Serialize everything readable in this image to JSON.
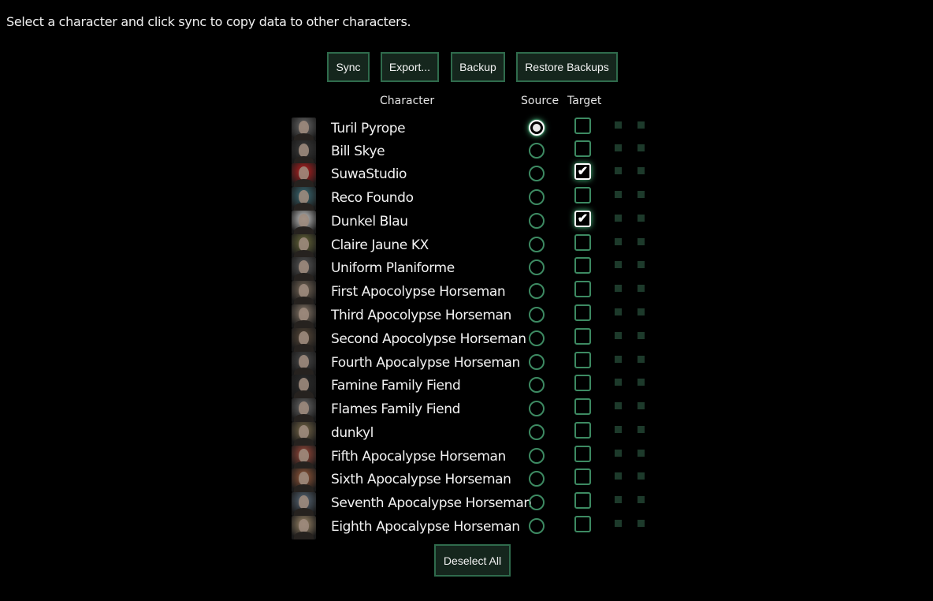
{
  "instructions": "Select a character and click sync to copy data to other characters.",
  "buttons": {
    "sync": "Sync",
    "export": "Export...",
    "backup": "Backup",
    "restore": "Restore Backups",
    "deselect_all": "Deselect All"
  },
  "headers": {
    "character": "Character",
    "source": "Source",
    "target": "Target"
  },
  "characters": [
    {
      "name": "Turil Pyrope",
      "source": true,
      "target": false
    },
    {
      "name": "Bill Skye",
      "source": false,
      "target": false
    },
    {
      "name": "SuwaStudio",
      "source": false,
      "target": true
    },
    {
      "name": "Reco Foundo",
      "source": false,
      "target": false
    },
    {
      "name": "Dunkel Blau",
      "source": false,
      "target": true
    },
    {
      "name": "Claire Jaune KX",
      "source": false,
      "target": false
    },
    {
      "name": "Uniform Planiforme",
      "source": false,
      "target": false
    },
    {
      "name": "First Apocolypse Horseman",
      "source": false,
      "target": false
    },
    {
      "name": "Third Apocolypse Horseman",
      "source": false,
      "target": false
    },
    {
      "name": "Second Apocolypse Horseman",
      "source": false,
      "target": false
    },
    {
      "name": "Fourth Apocalypse Horseman",
      "source": false,
      "target": false
    },
    {
      "name": "Famine Family Fiend",
      "source": false,
      "target": false
    },
    {
      "name": "Flames Family Fiend",
      "source": false,
      "target": false
    },
    {
      "name": "dunkyl",
      "source": false,
      "target": false
    },
    {
      "name": "Fifth Apocalypse Horseman",
      "source": false,
      "target": false
    },
    {
      "name": "Sixth Apocalypse Horseman",
      "source": false,
      "target": false
    },
    {
      "name": "Seventh Apocalypse Horseman",
      "source": false,
      "target": false
    },
    {
      "name": "Eighth Apocalypse Horseman",
      "source": false,
      "target": false
    }
  ],
  "colors": {
    "background": "#000000",
    "accent_border": "#2f6b4c",
    "button_fill": "#15261d",
    "control_border": "#3d8a62",
    "glow": "#4fc98a",
    "status_dot": "#1d3a2b"
  }
}
